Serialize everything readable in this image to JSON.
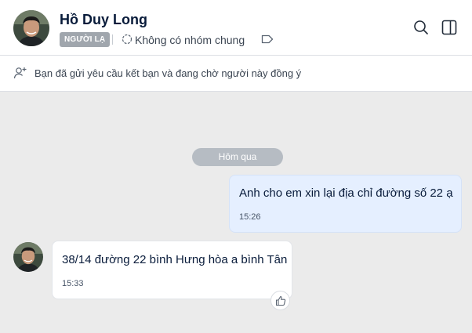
{
  "header": {
    "contact_name": "Hồ Duy Long",
    "badge": "NGƯỜI LẠ",
    "group_status": "Không có nhóm chung",
    "icons": [
      "avatar",
      "group-icon",
      "tag-icon",
      "search-icon",
      "side-panel-icon"
    ]
  },
  "notice": {
    "text": "Bạn đã gửi yêu cầu kết bạn và đang chờ người này đồng ý",
    "icon": "user-add-icon"
  },
  "conversation": {
    "date_separator": "Hôm qua",
    "messages": [
      {
        "direction": "outgoing",
        "text": "Anh cho em xin lại địa chỉ đường số 22 ạ",
        "time": "15:26"
      },
      {
        "direction": "incoming",
        "text": "38/14 đường 22 bình Hưng hòa a bình Tân",
        "time": "15:33"
      }
    ],
    "reaction_icon": "thumbs-up-icon"
  },
  "colors": {
    "outgoing_bubble": "#e5efff",
    "incoming_bubble": "#ffffff",
    "background": "#ebebeb",
    "badge": "#a0a6ad",
    "date_pill": "#b6bcc3"
  }
}
